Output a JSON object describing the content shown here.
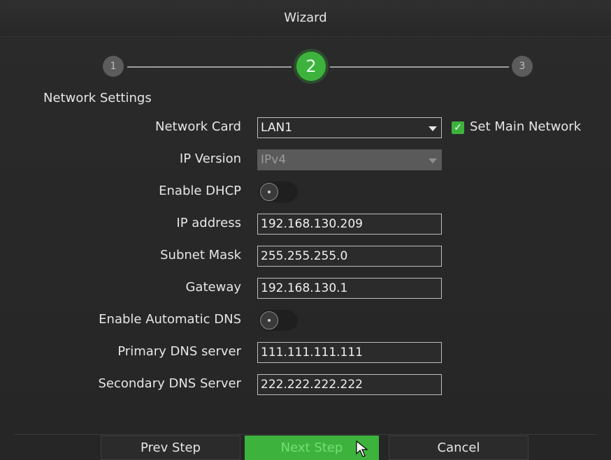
{
  "window": {
    "title": "Wizard"
  },
  "steps": [
    {
      "label": "1",
      "state": "inactive"
    },
    {
      "label": "2",
      "state": "active"
    },
    {
      "label": "3",
      "state": "inactive"
    }
  ],
  "section": {
    "title": "Network Settings"
  },
  "form": {
    "network_card": {
      "label": "Network Card",
      "value": "LAN1"
    },
    "set_main_network": {
      "label": "Set Main Network",
      "checked": true
    },
    "ip_version": {
      "label": "IP Version",
      "value": "IPv4",
      "disabled": true
    },
    "enable_dhcp": {
      "label": "Enable DHCP",
      "enabled": false
    },
    "ip_address": {
      "label": "IP address",
      "value": "192.168.130.209"
    },
    "subnet_mask": {
      "label": "Subnet Mask",
      "value": "255.255.255.0"
    },
    "gateway": {
      "label": "Gateway",
      "value": "192.168.130.1"
    },
    "enable_auto_dns": {
      "label": "Enable Automatic DNS",
      "enabled": false
    },
    "primary_dns": {
      "label": "Primary DNS server",
      "value": "111.111.111.111"
    },
    "secondary_dns": {
      "label": "Secondary DNS Server",
      "value": "222.222.222.222"
    }
  },
  "buttons": {
    "prev": "Prev Step",
    "next": "Next Step",
    "cancel": "Cancel"
  },
  "icons": {
    "dropdown": "chevron-down-icon",
    "checkbox": "checkmark-icon",
    "toggle": "toggle-switch-icon",
    "cursor": "mouse-pointer-icon"
  },
  "colors": {
    "accent": "#3db33d",
    "background": "#2b2b2b",
    "text": "#e6e6e6",
    "step_inactive": "#5c5c5c"
  }
}
